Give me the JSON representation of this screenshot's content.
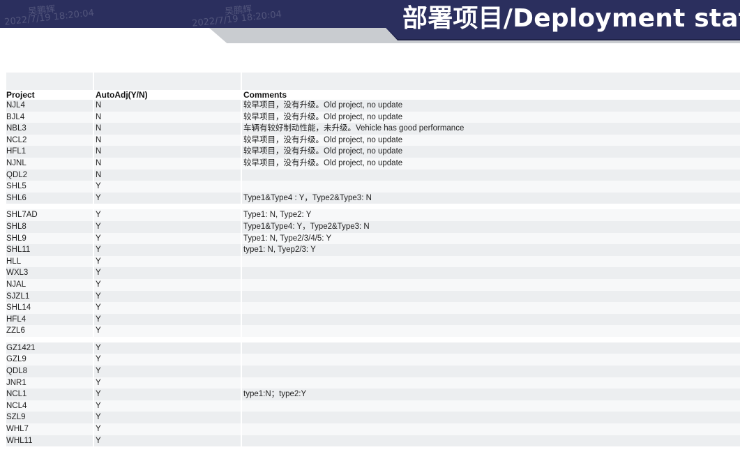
{
  "banner": {
    "title": "部署项目/Deployment stat",
    "watermarks": [
      "吴鹏辉",
      "2022/7/19 18:20:04",
      "吴鹏辉",
      "2022/7/19 18:20:04"
    ],
    "colors": {
      "navy": "#2b2f5e",
      "gray": "#c9ccd0"
    }
  },
  "table": {
    "headers": {
      "project": "Project",
      "autoadj": "AutoAdj(Y/N)",
      "comments": "Comments"
    },
    "rows": [
      {
        "project": "NJL4",
        "autoadj": "N",
        "comment": "较早项目，没有升级。Old project, no update"
      },
      {
        "project": "BJL4",
        "autoadj": "N",
        "comment": "较早项目，没有升级。Old project, no update"
      },
      {
        "project": "NBL3",
        "autoadj": "N",
        "comment": "车辆有较好制动性能，未升级。Vehicle has good performance"
      },
      {
        "project": "NCL2",
        "autoadj": "N",
        "comment": "较早项目，没有升级。Old project, no update"
      },
      {
        "project": "HFL1",
        "autoadj": "N",
        "comment": "较早项目，没有升级。Old project, no update"
      },
      {
        "project": "NJNL",
        "autoadj": "N",
        "comment": "较早项目，没有升级。Old project, no update"
      },
      {
        "project": "QDL2",
        "autoadj": "N",
        "comment": ""
      },
      {
        "project": "SHL5",
        "autoadj": "Y",
        "comment": ""
      },
      {
        "project": "SHL6",
        "autoadj": "Y",
        "comment": "Type1&Type4 : Y，Type2&Type3: N"
      },
      {
        "project": "SHL7AD",
        "autoadj": "Y",
        "comment": "Type1: N, Type2: Y"
      },
      {
        "project": "SHL8",
        "autoadj": "Y",
        "comment": "Type1&Type4: Y，Type2&Type3: N"
      },
      {
        "project": "SHL9",
        "autoadj": "Y",
        "comment": "Type1: N, Type2/3/4/5: Y"
      },
      {
        "project": "SHL11",
        "autoadj": "Y",
        "comment": "type1: N, Tyep2/3: Y"
      },
      {
        "project": "HLL",
        "autoadj": "Y",
        "comment": ""
      },
      {
        "project": "WXL3",
        "autoadj": "Y",
        "comment": ""
      },
      {
        "project": "NJAL",
        "autoadj": "Y",
        "comment": ""
      },
      {
        "project": "SJZL1",
        "autoadj": "Y",
        "comment": ""
      },
      {
        "project": "SHL14",
        "autoadj": "Y",
        "comment": ""
      },
      {
        "project": "HFL4",
        "autoadj": "Y",
        "comment": ""
      },
      {
        "project": "ZZL6",
        "autoadj": "Y",
        "comment": ""
      },
      {
        "project": "GZ1421",
        "autoadj": "Y",
        "comment": ""
      },
      {
        "project": "GZL9",
        "autoadj": "Y",
        "comment": ""
      },
      {
        "project": "QDL8",
        "autoadj": "Y",
        "comment": ""
      },
      {
        "project": "JNR1",
        "autoadj": "Y",
        "comment": ""
      },
      {
        "project": "NCL1",
        "autoadj": "Y",
        "comment": "type1:N；type2:Y"
      },
      {
        "project": "NCL4",
        "autoadj": "Y",
        "comment": ""
      },
      {
        "project": "SZL9",
        "autoadj": "Y",
        "comment": ""
      },
      {
        "project": "WHL7",
        "autoadj": "Y",
        "comment": ""
      },
      {
        "project": "WHL11",
        "autoadj": "Y",
        "comment": ""
      }
    ]
  }
}
